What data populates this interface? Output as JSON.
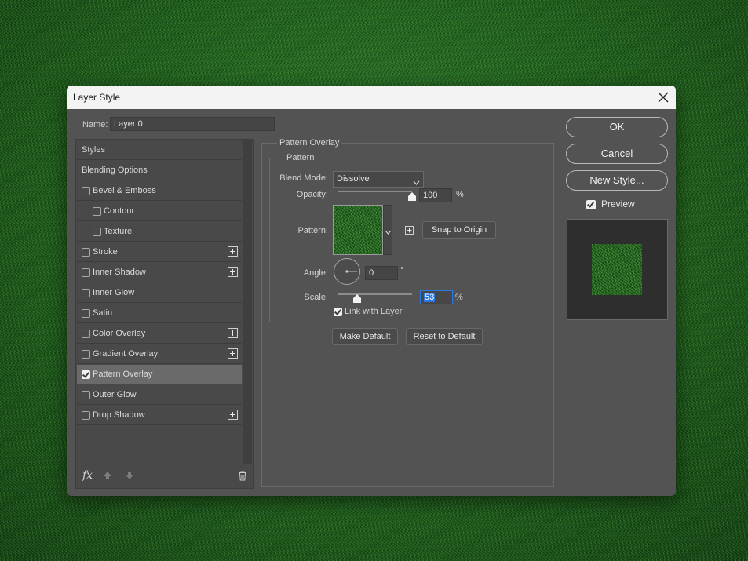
{
  "window": {
    "title": "Layer Style",
    "close_icon": "close-icon"
  },
  "name_field": {
    "label": "Name:",
    "value": "Layer 0"
  },
  "sidebar": {
    "items": [
      {
        "label": "Styles",
        "checkbox": false,
        "checked": false,
        "plus": false,
        "active": false
      },
      {
        "label": "Blending Options",
        "checkbox": false,
        "checked": false,
        "plus": false,
        "active": false
      },
      {
        "label": "Bevel & Emboss",
        "checkbox": true,
        "checked": false,
        "plus": false,
        "active": false
      },
      {
        "label": "Contour",
        "checkbox": true,
        "checked": false,
        "plus": false,
        "active": false
      },
      {
        "label": "Texture",
        "checkbox": true,
        "checked": false,
        "plus": false,
        "active": false
      },
      {
        "label": "Stroke",
        "checkbox": true,
        "checked": false,
        "plus": true,
        "active": false
      },
      {
        "label": "Inner Shadow",
        "checkbox": true,
        "checked": false,
        "plus": true,
        "active": false
      },
      {
        "label": "Inner Glow",
        "checkbox": true,
        "checked": false,
        "plus": false,
        "active": false
      },
      {
        "label": "Satin",
        "checkbox": true,
        "checked": false,
        "plus": false,
        "active": false
      },
      {
        "label": "Color Overlay",
        "checkbox": true,
        "checked": false,
        "plus": true,
        "active": false
      },
      {
        "label": "Gradient Overlay",
        "checkbox": true,
        "checked": false,
        "plus": true,
        "active": false
      },
      {
        "label": "Pattern Overlay",
        "checkbox": true,
        "checked": true,
        "plus": false,
        "active": true
      },
      {
        "label": "Outer Glow",
        "checkbox": true,
        "checked": false,
        "plus": false,
        "active": false
      },
      {
        "label": "Drop Shadow",
        "checkbox": true,
        "checked": false,
        "plus": true,
        "active": false
      }
    ],
    "footer_icons": [
      "fx-icon",
      "arrow-up-icon",
      "arrow-down-icon",
      "trash-icon"
    ],
    "fx_label": "fx"
  },
  "panel": {
    "section_title": "Pattern Overlay",
    "group_title": "Pattern",
    "blend_mode": {
      "label": "Blend Mode:",
      "value": "Dissolve"
    },
    "opacity": {
      "label": "Opacity:",
      "value": "100",
      "unit": "%",
      "level": 1.0
    },
    "pattern": {
      "label": "Pattern:",
      "snap_button": "Snap to Origin"
    },
    "angle": {
      "label": "Angle:",
      "value": "0",
      "unit": "°"
    },
    "scale": {
      "label": "Scale:",
      "value": "53",
      "unit": "%"
    },
    "link_with_layer": {
      "label": "Link with Layer",
      "checked": true
    },
    "make_default": "Make Default",
    "reset_default": "Reset to Default"
  },
  "buttons": {
    "ok": "OK",
    "cancel": "Cancel",
    "new_style": "New Style..."
  },
  "preview": {
    "label": "Preview",
    "checked": true
  },
  "colors": {
    "dialog_bg": "#535353",
    "titlebar_bg": "#f3f3f3",
    "accent": "#2b78e4",
    "grass": "#1f5f1f"
  }
}
